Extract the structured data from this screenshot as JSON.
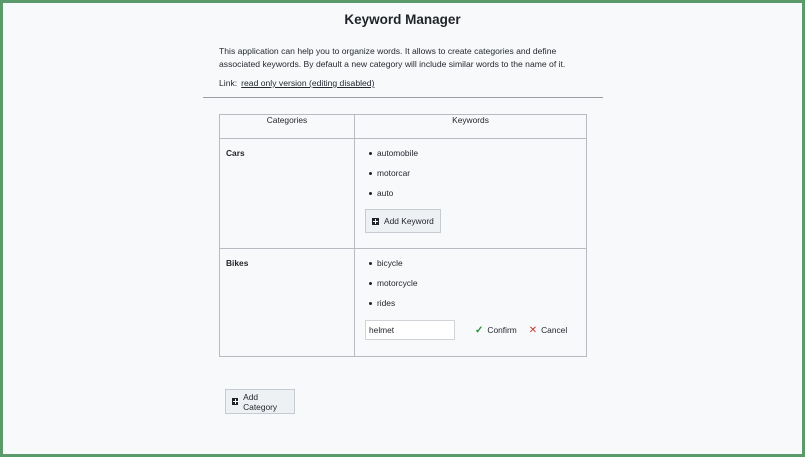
{
  "header": {
    "title": "Keyword Manager",
    "description": "This application can help you to organize words. It allows to create categories and define associated keywords. By default a new category will include similar words to the name of it.",
    "link_label": "Link:",
    "link_text": "read only version (editing disabled)"
  },
  "table": {
    "headers": [
      "Categories",
      "Keywords"
    ],
    "rows": [
      {
        "category": "Cars",
        "keywords": [
          "automobile",
          "motorcar",
          "auto"
        ],
        "add_keyword_label": "Add Keyword"
      },
      {
        "category": "Bikes",
        "keywords": [
          "bicycle",
          "motorcycle",
          "rides"
        ],
        "edit_value": "helmet",
        "confirm_label": "Confirm",
        "cancel_label": "Cancel"
      }
    ]
  },
  "add_category_label": "Add Category",
  "colors": {
    "frame_border": "#5a9a6b",
    "confirm_icon": "#2e8b3a",
    "cancel_icon": "#c0392b"
  },
  "icons": [
    "plus-square-icon",
    "check-icon",
    "x-icon"
  ]
}
